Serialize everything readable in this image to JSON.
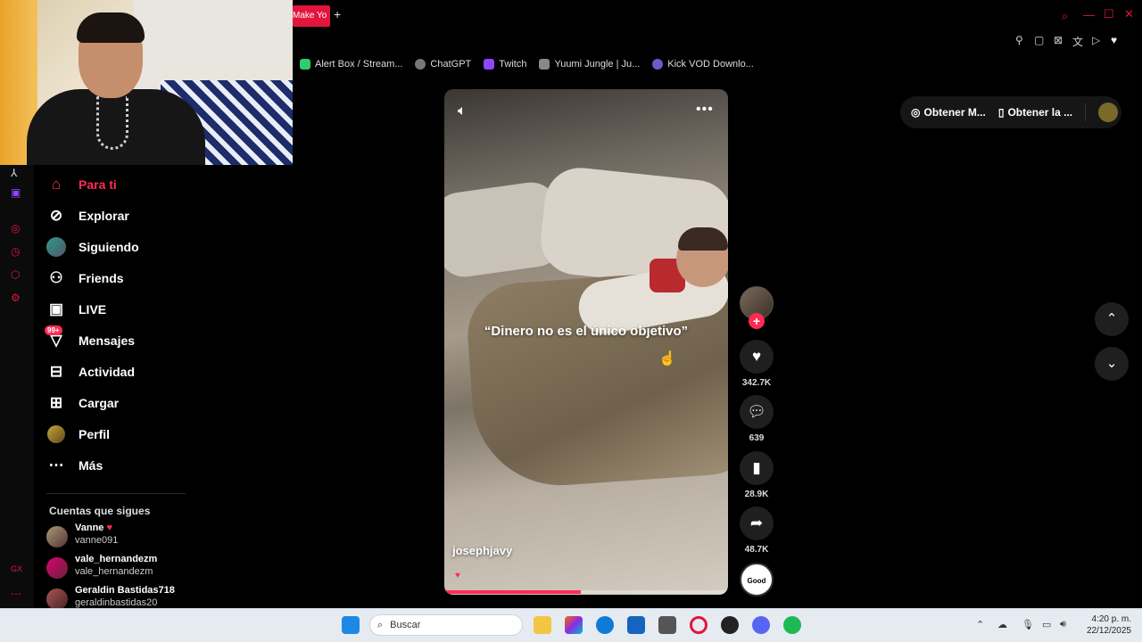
{
  "browser": {
    "tab_label": "Make Yo",
    "new_tab_icon": "plus-icon",
    "bookmarks": [
      {
        "label": "Alert Box / Stream...",
        "color": "#2ecc71"
      },
      {
        "label": "ChatGPT",
        "color": "#888888"
      },
      {
        "label": "Twitch",
        "color": "#9146ff"
      },
      {
        "label": "Yuumi Jungle | Ju...",
        "color": "#999999"
      },
      {
        "label": "Kick VOD Downlo...",
        "color": "#6a5acd"
      }
    ]
  },
  "nav": {
    "items": [
      {
        "label": "Para ti",
        "icon": "home-icon",
        "active": true
      },
      {
        "label": "Explorar",
        "icon": "compass-icon"
      },
      {
        "label": "Siguiendo",
        "icon": "following-avatar-icon"
      },
      {
        "label": "Friends",
        "icon": "friends-icon"
      },
      {
        "label": "LIVE",
        "icon": "live-tv-icon"
      },
      {
        "label": "Mensajes",
        "icon": "messages-icon",
        "badge": "99+"
      },
      {
        "label": "Actividad",
        "icon": "activity-icon"
      },
      {
        "label": "Cargar",
        "icon": "upload-icon"
      },
      {
        "label": "Perfil",
        "icon": "profile-icon"
      },
      {
        "label": "Más",
        "icon": "more-icon"
      }
    ],
    "following_title": "Cuentas que sigues",
    "accounts": [
      {
        "name": "Vanne",
        "handle": "vanne091"
      },
      {
        "name": "vale_hernandezm",
        "handle": "vale_hernandezm"
      },
      {
        "name": "Geraldin Bastidas718",
        "handle": "geraldinbastidas20"
      }
    ]
  },
  "video": {
    "caption": "“Dinero no es el único objetivo”",
    "author": "josephjavy",
    "progress": 0.48,
    "likes": "342.7K",
    "comments": "639",
    "saves": "28.9K",
    "shares": "48.7K",
    "music_label": "Good Vibes"
  },
  "pill": {
    "get_app_label": "Obtener M...",
    "get_desktop_label": "Obtener la ..."
  },
  "taskbar": {
    "search_placeholder": "Buscar",
    "time": "4:20 p. m.",
    "date": "22/12/2025"
  },
  "colors": {
    "accent": "#fe2c55",
    "browser_accent": "#e2153d"
  }
}
